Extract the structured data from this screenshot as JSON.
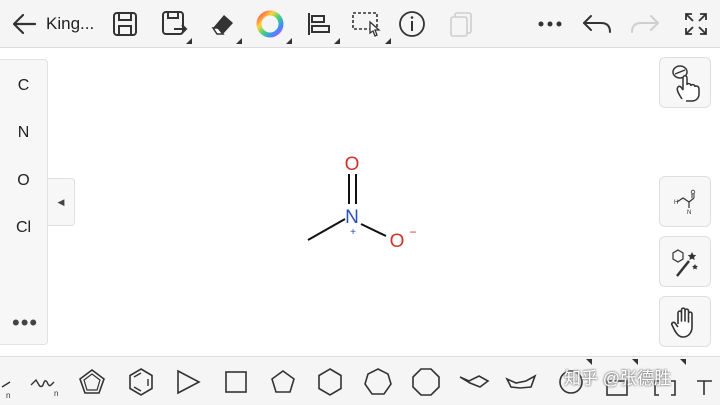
{
  "header": {
    "title": "King...",
    "icons": [
      "back-arrow-icon",
      "save-icon",
      "save-as-icon",
      "eraser-icon",
      "color-wheel-icon",
      "align-icon",
      "selection-icon",
      "info-icon",
      "copy-icon",
      "more-icon",
      "undo-icon",
      "redo-icon",
      "fullscreen-icon"
    ]
  },
  "elements_panel": {
    "items": [
      "C",
      "N",
      "O",
      "Cl"
    ],
    "more": "•••"
  },
  "molecule": {
    "atoms": [
      {
        "symbol": "O",
        "charge": "",
        "color": "#d0312d"
      },
      {
        "symbol": "N",
        "charge": "+",
        "color": "#2a4fbf"
      },
      {
        "symbol": "O",
        "charge": "−",
        "color": "#d0312d"
      }
    ]
  },
  "right_tools": [
    "hand-draw-icon",
    "functional-group-icon",
    "magic-wand-icon",
    "hand-pan-icon"
  ],
  "bottom_shapes": [
    "chain",
    "wavy-bond",
    "cyclopentadiene",
    "benzene",
    "triangle",
    "square",
    "pentagon",
    "hexagon",
    "heptagon",
    "octagon",
    "chair",
    "boat"
  ],
  "watermark": "知乎 @张德胜",
  "colors": {
    "toolbar_bg": "#f5f5f5",
    "nitrogen": "#2a4fbf",
    "oxygen": "#d0312d"
  }
}
